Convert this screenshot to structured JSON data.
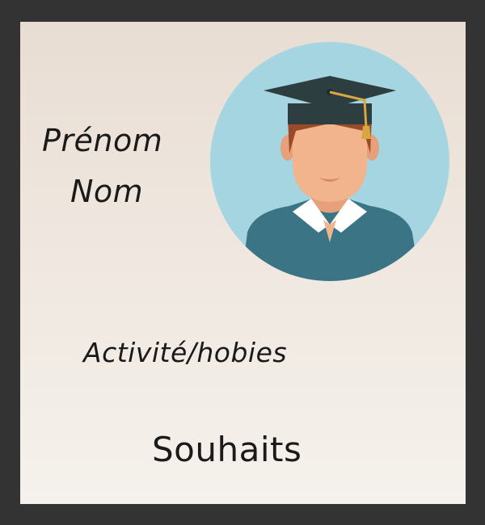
{
  "card": {
    "first_name_label": "Prénom",
    "last_name_label": "Nom",
    "hobbies_label": "Activité/hobies",
    "wishes_label": "Souhaits"
  },
  "avatar": {
    "icon": "graduate-avatar-icon",
    "colors": {
      "circle": "#a6d5e2",
      "skin": "#f2b48c",
      "hair": "#9a4a2a",
      "cap": "#2c3e3f",
      "tassel": "#d9a640",
      "shirt": "#3a7485",
      "collar": "#ffffff"
    }
  },
  "colors": {
    "frame": "#333333",
    "card_top": "#e8ddd3",
    "card_bottom": "#f5f1ec",
    "text": "#1a1a1a"
  }
}
